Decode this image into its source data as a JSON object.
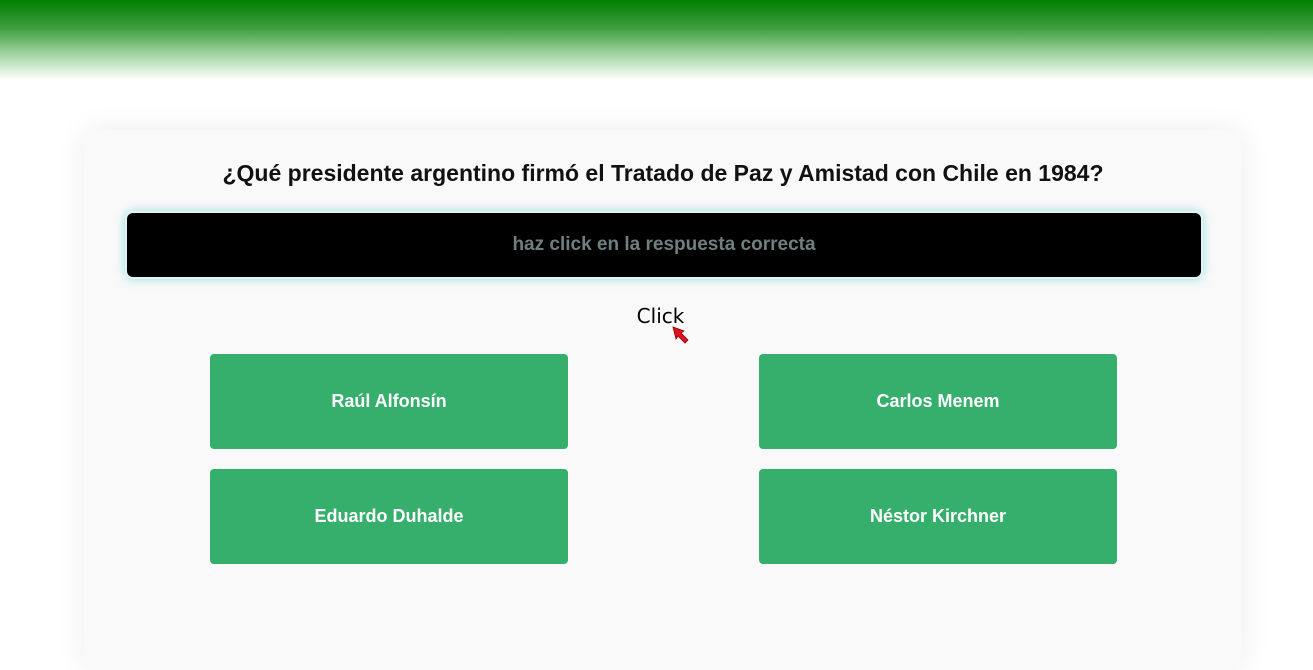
{
  "quiz": {
    "question": "¿Qué presidente argentino firmó el Tratado de Paz y Amistad con Chile en 1984?",
    "answer_placeholder": "haz click en la respuesta correcta",
    "hint_label": "Click",
    "options": [
      {
        "label": "Raúl Alfonsín"
      },
      {
        "label": "Carlos Menem"
      },
      {
        "label": "Eduardo Duhalde"
      },
      {
        "label": "Néstor Kirchner"
      }
    ]
  },
  "colors": {
    "header_gradient_top": "#008000",
    "option_background": "#36af6c",
    "answer_box_background": "#000000",
    "cursor_color": "#e0101e"
  },
  "icons": {
    "cursor": "arrow-cursor-icon"
  }
}
